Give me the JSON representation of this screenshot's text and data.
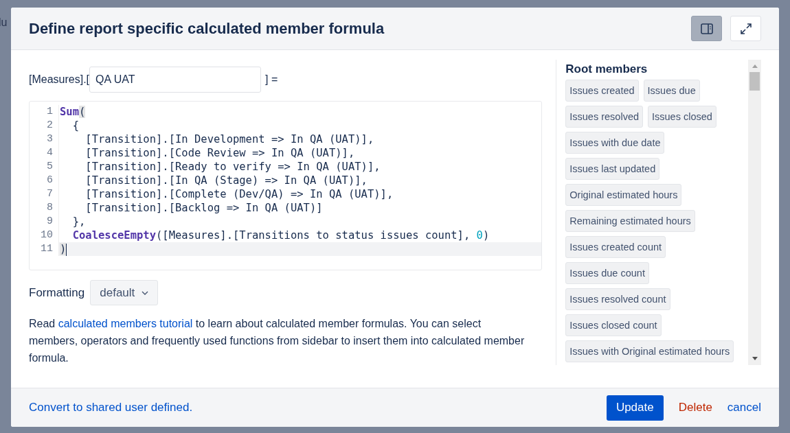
{
  "background_text": "lu",
  "dialog": {
    "title": "Define report specific calculated member formula",
    "header_buttons": [
      {
        "kind": "sidebar",
        "selected": true
      },
      {
        "kind": "expand",
        "selected": false
      }
    ],
    "member_name": {
      "prefix": "[Measures].[",
      "value": "QA UAT",
      "suffix": "] ="
    },
    "code_lines": [
      {
        "number": "1",
        "active": false,
        "tokens": [
          {
            "kind": "function",
            "text": "Sum"
          },
          {
            "kind": "bracket",
            "text": "("
          }
        ]
      },
      {
        "number": "2",
        "active": false,
        "tokens": [
          {
            "kind": "text",
            "text": "  {"
          }
        ]
      },
      {
        "number": "3",
        "active": false,
        "tokens": [
          {
            "kind": "text",
            "text": "    [Transition].[In Development => In QA (UAT)],"
          }
        ]
      },
      {
        "number": "4",
        "active": false,
        "tokens": [
          {
            "kind": "text",
            "text": "    [Transition].[Code Review => In QA (UAT)],"
          }
        ]
      },
      {
        "number": "5",
        "active": false,
        "tokens": [
          {
            "kind": "text",
            "text": "    [Transition].[Ready to verify => In QA (UAT)],"
          }
        ]
      },
      {
        "number": "6",
        "active": false,
        "tokens": [
          {
            "kind": "text",
            "text": "    [Transition].[In QA (Stage) => In QA (UAT)],"
          }
        ]
      },
      {
        "number": "7",
        "active": false,
        "tokens": [
          {
            "kind": "text",
            "text": "    [Transition].[Complete (Dev/QA) => In QA (UAT)],"
          }
        ]
      },
      {
        "number": "8",
        "active": false,
        "tokens": [
          {
            "kind": "text",
            "text": "    [Transition].[Backlog => In QA (UAT)]"
          }
        ]
      },
      {
        "number": "9",
        "active": false,
        "tokens": [
          {
            "kind": "text",
            "text": "  },"
          }
        ]
      },
      {
        "number": "10",
        "active": false,
        "tokens": [
          {
            "kind": "function",
            "text": "  CoalesceEmpty"
          },
          {
            "kind": "text",
            "text": "([Measures].[Transitions to status issues count], "
          },
          {
            "kind": "number",
            "text": "0"
          },
          {
            "kind": "text",
            "text": ")"
          }
        ]
      },
      {
        "number": "11",
        "active": true,
        "tokens": [
          {
            "kind": "bracket",
            "text": ")"
          }
        ]
      }
    ],
    "formatting": {
      "label": "Formatting",
      "value": "default"
    },
    "help": {
      "before": "Read ",
      "link": "calculated members tutorial",
      "after": " to learn about calculated member formulas. You can select members, operators and frequently used functions from sidebar to insert them into calculated member formula."
    },
    "sidebar": {
      "title": "Root members",
      "items": [
        "Issues created",
        "Issues due",
        "Issues resolved",
        "Issues closed",
        "Issues with due date",
        "Issues last updated",
        "Original estimated hours",
        "Remaining estimated hours",
        "Issues created count",
        "Issues due count",
        "Issues resolved count",
        "Issues closed count",
        "Issues with Original estimated hours"
      ]
    },
    "footer": {
      "convert_link": "Convert to shared user defined.",
      "update": "Update",
      "delete": "Delete",
      "cancel": "cancel"
    }
  }
}
